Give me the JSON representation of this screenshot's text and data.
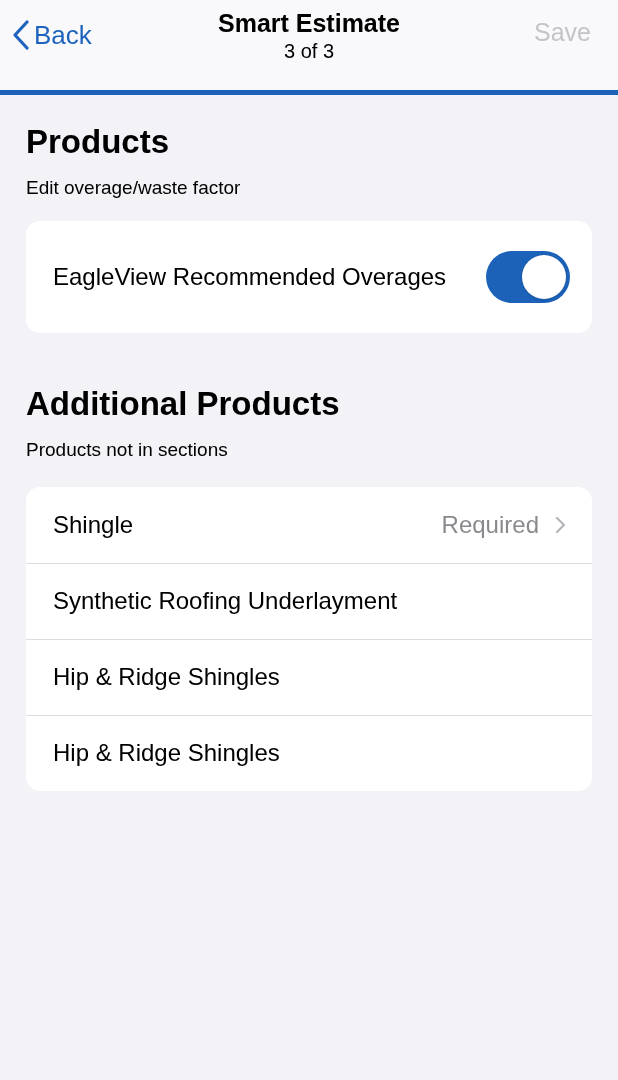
{
  "nav": {
    "back": "Back",
    "title": "Smart Estimate",
    "subtitle": "3 of 3",
    "save": {
      "label": "Save",
      "disabled": true
    }
  },
  "products": {
    "heading": "Products",
    "caption": "Edit overage/waste factor",
    "toggle": {
      "label": "EagleView Recommended Overages",
      "on": true
    }
  },
  "additional": {
    "heading": "Additional Products",
    "caption": "Products not in sections",
    "rows": [
      {
        "kind": "link",
        "label": "Shingle",
        "detail": "Required"
      },
      {
        "kind": "plain",
        "label": "Synthetic Roofing Underlayment"
      },
      {
        "kind": "plain",
        "label": "Hip & Ridge Shingles"
      },
      {
        "kind": "plain",
        "label": "Hip & Ridge Shingles"
      }
    ]
  }
}
